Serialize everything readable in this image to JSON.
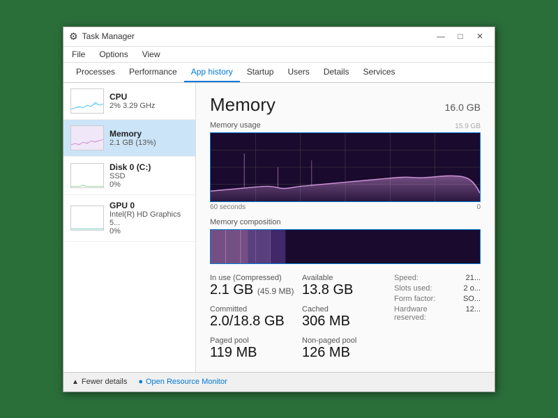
{
  "window": {
    "title": "Task Manager",
    "icon": "⚙"
  },
  "titlebar": {
    "minimize": "—",
    "maximize": "□",
    "close": "✕"
  },
  "menu": {
    "items": [
      "File",
      "Options",
      "View"
    ]
  },
  "tabs": [
    {
      "id": "processes",
      "label": "Processes"
    },
    {
      "id": "performance",
      "label": "Performance"
    },
    {
      "id": "app-history",
      "label": "App history"
    },
    {
      "id": "startup",
      "label": "Startup"
    },
    {
      "id": "users",
      "label": "Users"
    },
    {
      "id": "details",
      "label": "Details"
    },
    {
      "id": "services",
      "label": "Services"
    }
  ],
  "devices": [
    {
      "id": "cpu",
      "name": "CPU",
      "sub1": "2% 3.29 GHz",
      "sub2": "",
      "selected": false,
      "graphColor": "#4fc3f7"
    },
    {
      "id": "memory",
      "name": "Memory",
      "sub1": "2.1 GB (13%)",
      "sub2": "",
      "selected": true,
      "graphColor": "#ce93d8"
    },
    {
      "id": "disk",
      "name": "Disk 0 (C:)",
      "sub1": "SSD",
      "sub2": "0%",
      "selected": false,
      "graphColor": "#a5d6a7"
    },
    {
      "id": "gpu",
      "name": "GPU 0",
      "sub1": "Intel(R) HD Graphics 5...",
      "sub2": "0%",
      "selected": false,
      "graphColor": "#80cbc4"
    }
  ],
  "memory": {
    "title": "Memory",
    "total": "16.0 GB",
    "usage_label": "Memory usage",
    "graph_left": "60 seconds",
    "graph_right": "0",
    "max_label": "15.9 GB",
    "composition_label": "Memory composition",
    "in_use_label": "In use (Compressed)",
    "in_use_value": "2.1 GB (45.9 MB)",
    "available_label": "Available",
    "available_value": "13.8 GB",
    "committed_label": "Committed",
    "committed_value": "2.0/18.8 GB",
    "cached_label": "Cached",
    "cached_value": "306 MB",
    "paged_pool_label": "Paged pool",
    "paged_pool_value": "119 MB",
    "non_paged_pool_label": "Non-paged pool",
    "non_paged_pool_value": "126 MB",
    "speed_label": "Speed:",
    "speed_value": "21...",
    "slots_label": "Slots used:",
    "slots_value": "2 o...",
    "form_factor_label": "Form factor:",
    "form_factor_value": "SO...",
    "hardware_reserved_label": "Hardware reserved:",
    "hardware_reserved_value": "12..."
  },
  "footer": {
    "fewer_details": "Fewer details",
    "open_resource_monitor": "Open Resource Monitor"
  }
}
